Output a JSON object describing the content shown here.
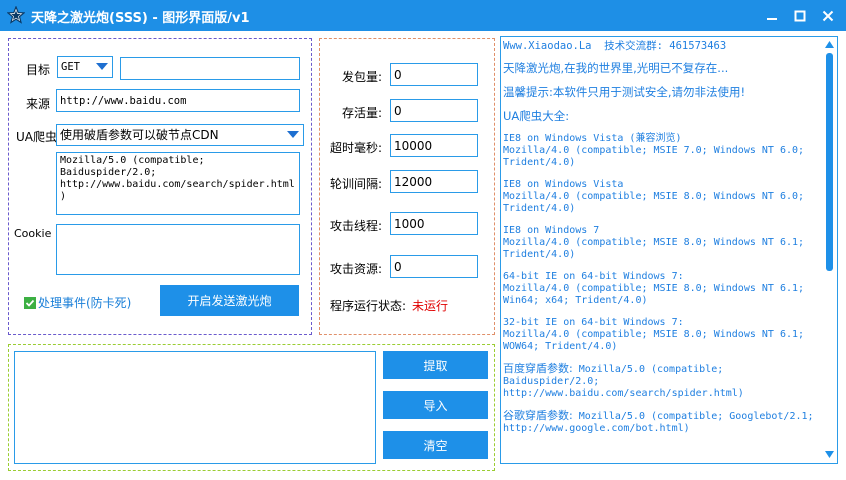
{
  "window": {
    "title": "天降之激光炮(SSS) - 图形界面版/v1",
    "app_icon": "star-icon",
    "controls": {
      "minimize": "minimize-icon",
      "maximize": "maximize-icon",
      "close": "close-icon"
    },
    "accent_color": "#1e8fe6"
  },
  "left": {
    "target_label": "目标",
    "method_value": "GET",
    "target_value": "",
    "source_label": "来源",
    "source_value": "http://www.baidu.com",
    "ua_label": "UA爬虫",
    "ua_select_value": "使用破盾参数可以破节点CDN",
    "ua_text": "Mozilla/5.0 (compatible;\nBaiduspider/2.0;\nhttp://www.baidu.com/search/spider.html)",
    "cookie_label": "Cookie",
    "cookie_value": "",
    "handle_events_label": "处理事件(防卡死)",
    "handle_events_checked": true,
    "start_button": "开启发送激光炮"
  },
  "mid": {
    "packets_label": "发包量:",
    "packets_value": "0",
    "alive_label": "存活量:",
    "alive_value": "0",
    "timeout_label": "超时毫秒:",
    "timeout_value": "10000",
    "interval_label": "轮训间隔:",
    "interval_value": "12000",
    "threads_label": "攻击线程:",
    "threads_value": "1000",
    "resources_label": "攻击资源:",
    "resources_value": "0",
    "status_label": "程序运行状态:",
    "status_value": "未运行",
    "status_color": "#e00000"
  },
  "bottom": {
    "textarea_value": "",
    "extract_button": "提取",
    "import_button": "导入",
    "clear_button": "清空"
  },
  "info": {
    "header": "Www.Xiaodao.La  技术交流群: 461573463",
    "slogan": "天降激光炮,在我的世界里,光明已不复存在...",
    "tip": "温馨提示:本软件只用于测试安全,请勿非法使用!",
    "ua_title": "UA爬虫大全:",
    "e1_title": "IE8 on Windows Vista (兼容浏览)",
    "e1_l1": "Mozilla/4.0 (compatible; MSIE 7.0; Windows NT 6.0;",
    "e1_l2": "Trident/4.0)",
    "e2_title": "IE8 on Windows Vista",
    "e2_l1": "Mozilla/4.0 (compatible; MSIE 8.0; Windows NT 6.0;",
    "e2_l2": "Trident/4.0)",
    "e3_title": "IE8 on Windows 7",
    "e3_l1": "Mozilla/4.0 (compatible; MSIE 8.0; Windows NT 6.1;",
    "e3_l2": "Trident/4.0)",
    "e4_title": "64-bit IE on 64-bit Windows 7:",
    "e4_l1": "Mozilla/4.0 (compatible; MSIE 8.0; Windows NT 6.1;",
    "e4_l2": "Win64; x64; Trident/4.0)",
    "e5_title": "32-bit IE on 64-bit Windows 7:",
    "e5_l1": "Mozilla/4.0 (compatible; MSIE 8.0; Windows NT 6.1;",
    "e5_l2": "WOW64; Trident/4.0)",
    "e6_prefix": "百度穿盾参数:",
    "e6_l1": " Mozilla/5.0 (compatible;",
    "e6_l2": "Baiduspider/2.0;",
    "e6_l3": "http://www.baidu.com/search/spider.html)",
    "e7_prefix": "谷歌穿盾参数:",
    "e7_l1": " Mozilla/5.0 (compatible; Googlebot/2.1;",
    "e7_l2": "http://www.google.com/bot.html)",
    "text_color": "#1f7fe0"
  }
}
